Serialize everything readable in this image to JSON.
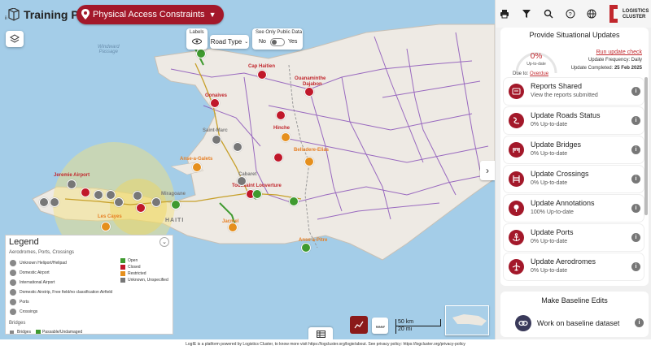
{
  "header": {
    "title": "Training Page",
    "layer_select": "Physical Access Constraints"
  },
  "map_controls": {
    "labels_title": "Labels",
    "road_type": "Road Type",
    "public_title": "See Only Public Data",
    "no_label": "No",
    "yes_label": "Yes"
  },
  "map_labels": {
    "sea": "Windward\nPassage",
    "cap_haitien": "Cap Haitien",
    "ouanaminthe": "Ouanaminthe",
    "dajabon": "Dajabon",
    "gonaives": "Gonaives",
    "saint_marc": "Saint-Marc",
    "hinche": "Hinche",
    "anse_a_galets": "Anse-a-Galets",
    "belladere": "Belladere-Elias",
    "cabaret": "Cabaret",
    "toussaint": "Toussaint Louverture",
    "jeremie": "Jeremie Airport",
    "les_cayes": "Les Cayes",
    "miragoane": "Miragoane",
    "haiti": "HAITI",
    "jacmel": "Jacmel",
    "anse_a_pitre": "Anse-a-Pitre"
  },
  "legend": {
    "title": "Legend",
    "section1": "Aerodromes, Ports, Crossings",
    "items": [
      "Unknown Heliport/Helipad",
      "Domestic Airport",
      "International Airport",
      "Domestic Airstrip, Free field/no classification Airfield",
      "Ports",
      "Crossings"
    ],
    "statuses": [
      {
        "label": "Open",
        "color": "#3f9a2f"
      },
      {
        "label": "Closed",
        "color": "#c0182a"
      },
      {
        "label": "Restricted",
        "color": "#e58f1d"
      },
      {
        "label": "Unknown, Unspecified",
        "color": "#777777"
      }
    ],
    "section2": "Bridges",
    "bridge_label": "Bridges",
    "bridge_status": "Passable/Undamaged"
  },
  "scale": {
    "km": "50 km",
    "mi": "20 mi"
  },
  "situational": {
    "title": "Provide Situational Updates",
    "percent": "0%",
    "percent_sub": "Up-to-date",
    "due_label": "Due to:",
    "due_value": "Overdue",
    "run_link": "Run update check",
    "frequency_label": "Update Frequency:",
    "frequency_value": "Daily",
    "completed_label": "Update Completed:",
    "completed_value": "25 Feb 2025",
    "tasks": [
      {
        "title": "Reports Shared",
        "sub": "View the reports submitted",
        "icon": "reports-icon"
      },
      {
        "title": "Update Roads Status",
        "sub": "0% Up-to-date",
        "icon": "road-icon"
      },
      {
        "title": "Update Bridges",
        "sub": "0% Up-to-date",
        "icon": "bridge-icon"
      },
      {
        "title": "Update Crossings",
        "sub": "0% Up-to-date",
        "icon": "crossing-icon"
      },
      {
        "title": "Update Annotations",
        "sub": "100% Up-to-date",
        "icon": "annotation-icon"
      },
      {
        "title": "Update Ports",
        "sub": "0% Up-to-date",
        "icon": "anchor-icon"
      },
      {
        "title": "Update Aerodromes",
        "sub": "0% Up-to-date",
        "icon": "plane-icon"
      }
    ]
  },
  "baseline": {
    "title": "Make Baseline Edits",
    "item": "Work on baseline dataset"
  },
  "logo_text": "LOGISTICS\nCLUSTER",
  "footer": "LogIE is a platform powered by Logistics Cluster, to know more visit https://logcluster.org/logie/about. See privacy policy: https://logcluster.org/privacy-policy",
  "colors": {
    "brand": "#a3182a",
    "open": "#3f9a2f",
    "closed": "#c0182a",
    "restricted": "#e58f1d",
    "unknown": "#777777"
  }
}
